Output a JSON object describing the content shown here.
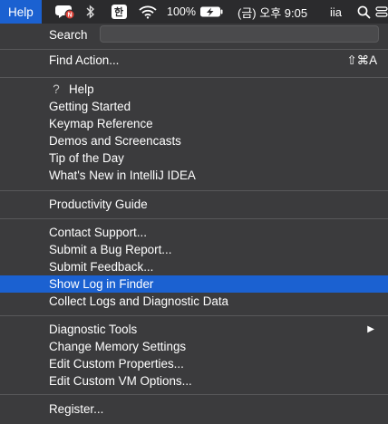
{
  "menubar": {
    "help_label": "Help",
    "battery_percent": "100%",
    "clock": "(금) 오후 9:05",
    "user": "iia",
    "input_method": "한"
  },
  "menu": {
    "search_label": "Search",
    "search_placeholder": "",
    "items": [
      {
        "label": "Find Action...",
        "shortcut": "⇧⌘A"
      },
      {
        "label": "Help"
      },
      {
        "label": "Getting Started"
      },
      {
        "label": "Keymap Reference"
      },
      {
        "label": "Demos and Screencasts"
      },
      {
        "label": "Tip of the Day"
      },
      {
        "label": "What's New in IntelliJ IDEA"
      },
      {
        "label": "Productivity Guide"
      },
      {
        "label": "Contact Support..."
      },
      {
        "label": "Submit a Bug Report..."
      },
      {
        "label": "Submit Feedback..."
      },
      {
        "label": "Show Log in Finder"
      },
      {
        "label": "Collect Logs and Diagnostic Data"
      },
      {
        "label": "Diagnostic Tools"
      },
      {
        "label": "Change Memory Settings"
      },
      {
        "label": "Edit Custom Properties..."
      },
      {
        "label": "Edit Custom VM Options..."
      },
      {
        "label": "Register..."
      }
    ],
    "help_prefix_icon": "?",
    "submenu_arrow": "▶"
  },
  "colors": {
    "menu_bg": "#3b3b3d",
    "menubar_bg": "#2b2b2d",
    "selection": "#1b61d1",
    "separator": "#58585a",
    "text": "#ffffff"
  }
}
